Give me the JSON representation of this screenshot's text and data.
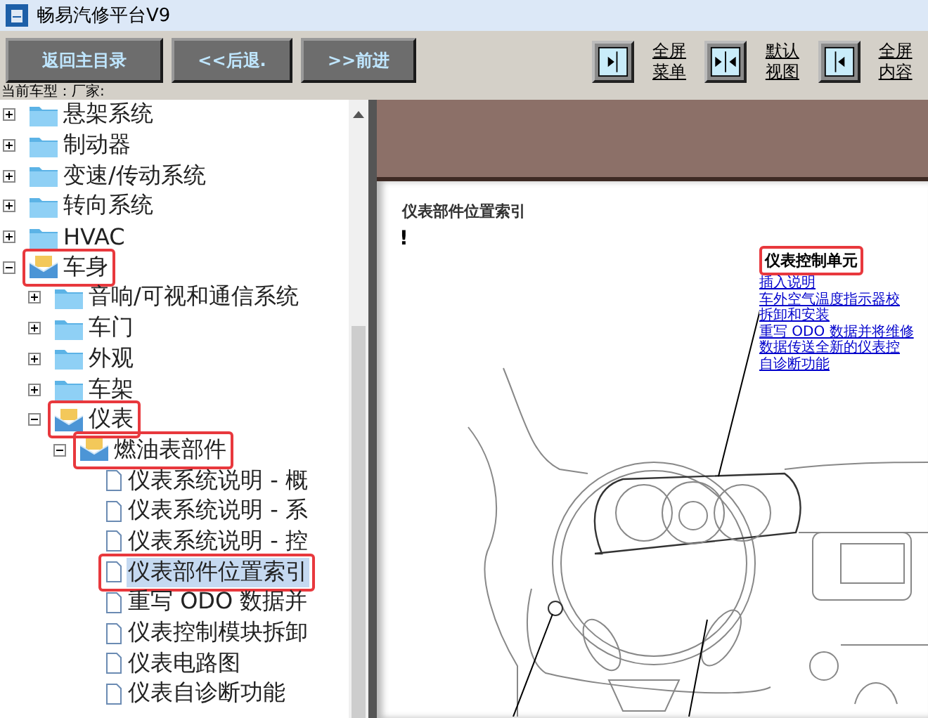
{
  "window": {
    "title": "畅易汽修平台V9"
  },
  "nav_buttons": [
    {
      "label": "返回主目录"
    },
    {
      "label": "<<后退."
    },
    {
      "label": ">>前进"
    }
  ],
  "view_buttons": [
    {
      "kind": "right",
      "label": "全屏菜单"
    },
    {
      "kind": "both",
      "label": "默认视图"
    },
    {
      "kind": "left",
      "label": "全屏内容"
    }
  ],
  "vehicle_info": "当前车型：厂家:",
  "tree": [
    {
      "label": "悬架系统",
      "kind": "folder",
      "expanded": false,
      "highlighted": false,
      "selected": false
    },
    {
      "label": "制动器",
      "kind": "folder",
      "expanded": false,
      "highlighted": false,
      "selected": false
    },
    {
      "label": "变速/传动系统",
      "kind": "folder",
      "expanded": false,
      "highlighted": false,
      "selected": false
    },
    {
      "label": "转向系统",
      "kind": "folder",
      "expanded": false,
      "highlighted": false,
      "selected": false
    },
    {
      "label": "HVAC",
      "kind": "folder",
      "expanded": false,
      "highlighted": false,
      "selected": false
    },
    {
      "label": "车身",
      "kind": "folder",
      "expanded": true,
      "highlighted": true,
      "selected": false,
      "children": [
        {
          "label": "音响/可视和通信系统",
          "kind": "folder",
          "expanded": false,
          "highlighted": false,
          "selected": false
        },
        {
          "label": "车门",
          "kind": "folder",
          "expanded": false,
          "highlighted": false,
          "selected": false
        },
        {
          "label": "外观",
          "kind": "folder",
          "expanded": false,
          "highlighted": false,
          "selected": false
        },
        {
          "label": "车架",
          "kind": "folder",
          "expanded": false,
          "highlighted": false,
          "selected": false
        },
        {
          "label": "仪表",
          "kind": "folder",
          "expanded": true,
          "highlighted": true,
          "selected": false,
          "children": [
            {
              "label": "燃油表部件",
              "kind": "folder",
              "expanded": true,
              "highlighted": true,
              "selected": false,
              "children": [
                {
                  "label": "仪表系统说明 - 概",
                  "kind": "page",
                  "highlighted": false,
                  "selected": false
                },
                {
                  "label": "仪表系统说明 - 系",
                  "kind": "page",
                  "highlighted": false,
                  "selected": false
                },
                {
                  "label": "仪表系统说明 - 控",
                  "kind": "page",
                  "highlighted": false,
                  "selected": false
                },
                {
                  "label": "仪表部件位置索引",
                  "kind": "page",
                  "highlighted": true,
                  "selected": true
                },
                {
                  "label": "重写 ODO 数据并",
                  "kind": "page",
                  "highlighted": false,
                  "selected": false
                },
                {
                  "label": "仪表控制模块拆卸",
                  "kind": "page",
                  "highlighted": false,
                  "selected": false
                },
                {
                  "label": "仪表电路图",
                  "kind": "page",
                  "highlighted": false,
                  "selected": false
                },
                {
                  "label": "仪表自诊断功能",
                  "kind": "page",
                  "highlighted": false,
                  "selected": false
                }
              ]
            }
          ]
        }
      ]
    }
  ],
  "document": {
    "title": "仪表部件位置索引",
    "mark": "!",
    "callout": {
      "label": "仪表控制单元",
      "highlighted": true,
      "links": [
        "插入说明",
        "车外空气温度指示器校",
        "拆卸和安装",
        "重写 ODO 数据并将维修",
        "数据传送全新的仪表控",
        "自诊断功能"
      ]
    }
  }
}
